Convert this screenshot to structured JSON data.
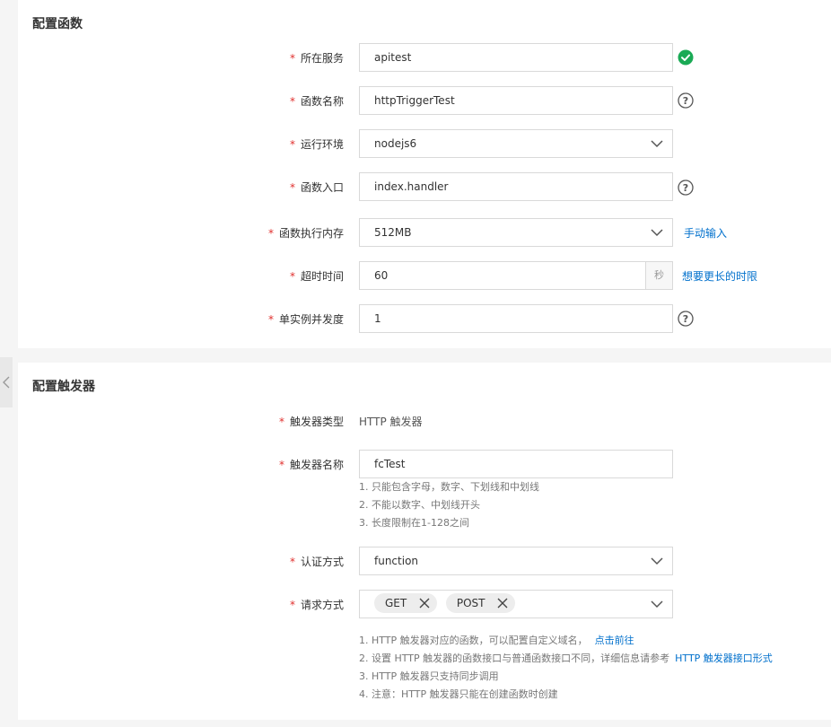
{
  "function_config": {
    "title": "配置函数",
    "service": {
      "label": "所在服务",
      "value": "apitest",
      "status_icon": "check-circle-icon",
      "status_color": "#1aaa55"
    },
    "function_name": {
      "label": "函数名称",
      "value": "httpTriggerTest"
    },
    "runtime": {
      "label": "运行环境",
      "value": "nodejs6"
    },
    "handler": {
      "label": "函数入口",
      "value": "index.handler"
    },
    "memory": {
      "label": "函数执行内存",
      "value": "512MB",
      "link": "手动输入"
    },
    "timeout": {
      "label": "超时时间",
      "value": "60",
      "unit": "秒",
      "link": "想要更长的时限"
    },
    "concurrency": {
      "label": "单实例并发度",
      "value": "1"
    }
  },
  "trigger_config": {
    "title": "配置触发器",
    "trigger_type": {
      "label": "触发器类型",
      "value": "HTTP 触发器"
    },
    "trigger_name": {
      "label": "触发器名称",
      "value": "fcTest",
      "hints": [
        "1. 只能包含字母，数字、下划线和中划线",
        "2. 不能以数字、中划线开头",
        "3. 长度限制在1-128之间"
      ]
    },
    "auth": {
      "label": "认证方式",
      "value": "function"
    },
    "methods": {
      "label": "请求方式",
      "tags": [
        "GET",
        "POST"
      ]
    },
    "notes": {
      "line1": "1. HTTP 触发器对应的函数，可以配置自定义域名，",
      "line1_link": "点击前往",
      "line2": "2. 设置 HTTP 触发器的函数接口与普通函数接口不同，详细信息请参考",
      "line2_link": "HTTP 触发器接口形式",
      "line3": "3. HTTP 触发器只支持同步调用",
      "line4": "4. 注意：HTTP 触发器只能在创建函数时创建"
    }
  },
  "required_mark": "*",
  "colors": {
    "link": "#0070cc",
    "required": "#e0302e"
  }
}
